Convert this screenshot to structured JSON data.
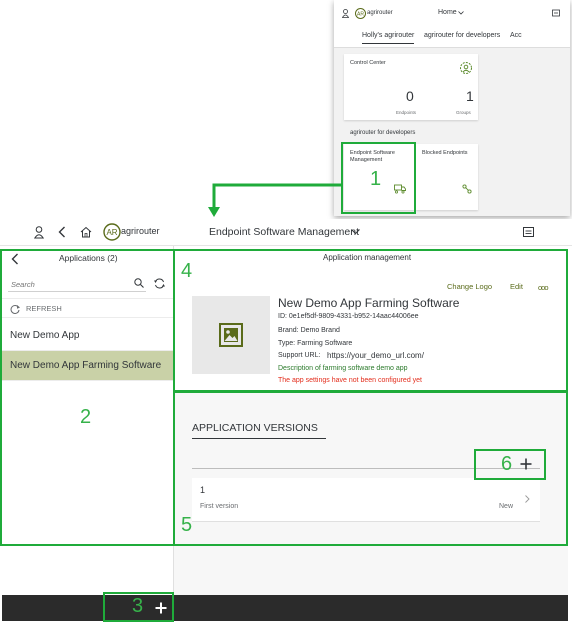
{
  "inset": {
    "home_label": "Home",
    "tabs": [
      "Holly's agrirouter",
      "agrirouter for developers",
      "Acc"
    ],
    "control_center": {
      "title": "Control Center",
      "endpoints_value": "0",
      "endpoints_label": "Endpoints",
      "groups_value": "1",
      "groups_label": "Groups"
    },
    "developers_section": "agrirouter for developers",
    "esm_tile": {
      "title_line1": "Endpoint Software",
      "title_line2": "Management"
    },
    "blocked_tile": {
      "title": "Blocked Endpoints"
    }
  },
  "logo_text": "agrirouter",
  "header": {
    "title": "Endpoint Software Management"
  },
  "sidebar": {
    "title": "Applications (2)",
    "search_placeholder": "Search",
    "refresh_label": "REFRESH",
    "items": [
      {
        "label": "New Demo App"
      },
      {
        "label": "New Demo App Farming Software"
      }
    ]
  },
  "main": {
    "title": "Application management",
    "actions": {
      "change_logo": "Change Logo",
      "edit": "Edit",
      "more": "ooo"
    },
    "app": {
      "name": "New Demo App Farming Software",
      "id": "ID: 0e1ef5df-9809-4331-b952-14aac44006ee",
      "brand": "Brand: Demo Brand",
      "type": "Type: Farming Software",
      "support_label": "Support URL:",
      "support_url": "https://your_demo_url.com/",
      "description": "Description of farming software demo app",
      "warning": "The app settings have not been configured yet"
    },
    "versions_title": "APPLICATION VERSIONS",
    "versions": [
      {
        "number": "1",
        "description": "First version",
        "status": "New"
      }
    ]
  },
  "callouts": [
    "1",
    "2",
    "3",
    "4",
    "5",
    "6"
  ],
  "colors": {
    "accent": "#1fab3a",
    "callout": "#36b24a",
    "selected": "#c9d1a7",
    "warning": "#e32d1c",
    "link": "#5a6b1a"
  }
}
